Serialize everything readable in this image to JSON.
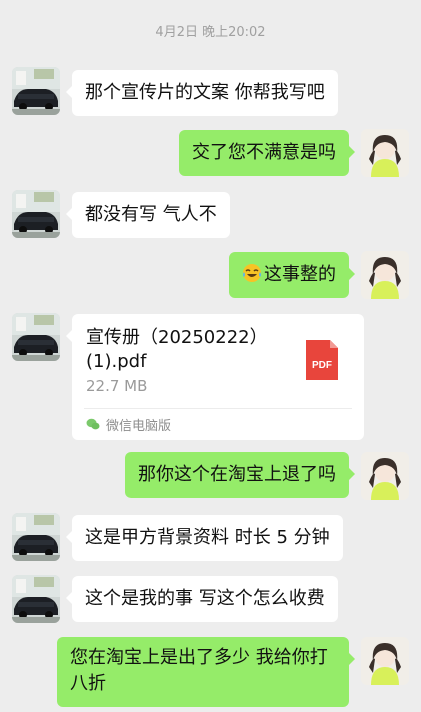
{
  "header": {
    "timestamp": "4月2日 晚上20:02"
  },
  "colors": {
    "background": "#ededed",
    "incoming_bubble": "#ffffff",
    "outgoing_bubble": "#95ec69",
    "pdf_red": "#e8453c"
  },
  "messages": [
    {
      "side": "in",
      "text": "那个宣传片的文案 你帮我写吧"
    },
    {
      "side": "out",
      "text": "交了您不满意是吗"
    },
    {
      "side": "in",
      "text": "都没有写 气人不"
    },
    {
      "side": "out",
      "emoji": "face-with-tears-of-joy",
      "text": "这事整的"
    },
    {
      "side": "in",
      "type": "file",
      "file": {
        "name": "宣传册（20250222）(1).pdf",
        "size": "22.7 MB",
        "icon_label": "PDF",
        "source": "微信电脑版"
      }
    },
    {
      "side": "out",
      "text": "那你这个在淘宝上退了吗"
    },
    {
      "side": "in",
      "text": "这是甲方背景资料 时长 5 分钟"
    },
    {
      "side": "in",
      "text": "这个是我的事 写这个怎么收费"
    },
    {
      "side": "out",
      "text": "您在淘宝上是出了多少 我给你打八折"
    }
  ]
}
